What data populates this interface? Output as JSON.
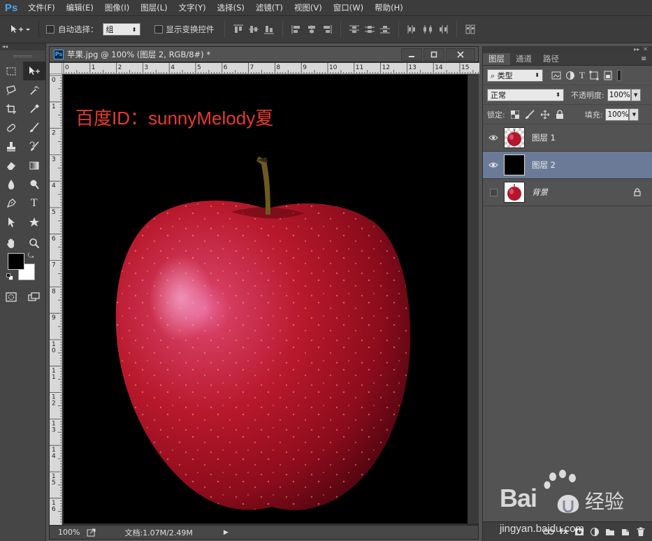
{
  "app": {
    "logo": "Ps"
  },
  "menu": {
    "items": [
      {
        "label": "文件(F)"
      },
      {
        "label": "编辑(E)"
      },
      {
        "label": "图像(I)"
      },
      {
        "label": "图层(L)"
      },
      {
        "label": "文字(Y)"
      },
      {
        "label": "选择(S)"
      },
      {
        "label": "滤镜(T)"
      },
      {
        "label": "视图(V)"
      },
      {
        "label": "窗口(W)"
      },
      {
        "label": "帮助(H)"
      }
    ]
  },
  "options": {
    "auto_select_label": "自动选择：",
    "auto_select_value": "组",
    "show_transform_label": "显示变换控件"
  },
  "document": {
    "icon_label": "Ps",
    "title": "苹果.jpg @ 100% (图层 2, RGB/8#) *",
    "canvas_text": "百度ID：sunnyMelody夏",
    "ruler_top_labels": [
      "0",
      "1",
      "2",
      "3",
      "4",
      "5",
      "6",
      "7",
      "8",
      "9",
      "10",
      "11",
      "12",
      "13",
      "14",
      "15"
    ],
    "ruler_left_labels": [
      "0",
      "1",
      "2",
      "3",
      "4",
      "5",
      "6",
      "7",
      "8",
      "9",
      "10",
      "11",
      "12",
      "13",
      "14",
      "15",
      "16"
    ],
    "zoom": "100%",
    "doc_info": "文档:1.07M/2.49M"
  },
  "layers_panel": {
    "tabs": [
      {
        "label": "图层",
        "active": true
      },
      {
        "label": "通道",
        "active": false
      },
      {
        "label": "路径",
        "active": false
      }
    ],
    "filter_type": "类型",
    "blend_mode": "正常",
    "opacity_label": "不透明度:",
    "opacity_value": "100%",
    "lock_label": "锁定:",
    "fill_label": "填充:",
    "fill_value": "100%",
    "layers": [
      {
        "name": "图层 1",
        "visible": true,
        "selected": false
      },
      {
        "name": "图层 2",
        "visible": true,
        "selected": true
      },
      {
        "name": "背景",
        "visible": false,
        "selected": false,
        "locked": true
      }
    ],
    "bottom_fx": "fx"
  },
  "watermark": {
    "logo_text": "Bai",
    "logo_cn": "经验",
    "url": "jingyan.baidu.com"
  },
  "colors": {
    "canvas_text": "#e83a2c",
    "selected_layer": "#6b7b97",
    "ps_blue": "#4aa6f0"
  }
}
